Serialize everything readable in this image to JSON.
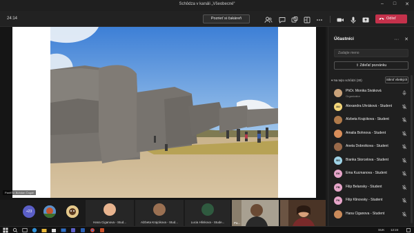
{
  "window": {
    "title": "Schôdza v kanáli „Všeobecné“"
  },
  "toolbar": {
    "timer": "24:14",
    "waiting_button": "Pozrieť si čakáreň",
    "leave_button": "Odísť"
  },
  "stage": {
    "presenter_label": "PanItTv. Bohdan Čagáň"
  },
  "strip": {
    "overflow_count": "+23",
    "tiles": [
      {
        "name": "Hana Ciganova - Stud..."
      },
      {
        "name": "Alzbeta Krajcikova - Stud..."
      },
      {
        "name": "Lucia Hlinkova - Stude..."
      },
      {
        "name": "Pa..."
      }
    ]
  },
  "panel": {
    "title": "Účastníci",
    "invite_placeholder": "Zadajte meno",
    "share_button": "Zdieľať pozvánku",
    "section_label": "Na tejto schôdzi (30)",
    "mute_all_button": "Stlmiť všetkých",
    "participants": [
      {
        "name": "PhDr. Monika Siváková",
        "role": "Organizátor",
        "initials": "",
        "color": "#c9a27a"
      },
      {
        "name": "Alexandra Uhráková - Student",
        "role": "",
        "initials": "AU",
        "color": "#f5d77a"
      },
      {
        "name": "Alzbeta Krajcikova - Student",
        "role": "",
        "initials": "",
        "color": "#b07a4a"
      },
      {
        "name": "Amalia Bohnova - Student",
        "role": "",
        "initials": "",
        "color": "#d98e5a"
      },
      {
        "name": "Aneta Dobrotkova - Student",
        "role": "",
        "initials": "",
        "color": "#9a6a4a"
      },
      {
        "name": "Bianka Storcelova - Student",
        "role": "",
        "initials": "BS",
        "color": "#9fd3e6"
      },
      {
        "name": "Ema Kucmanova - Student",
        "role": "",
        "initials": "EK",
        "color": "#e6a5c9"
      },
      {
        "name": "Filip Belansky - Student",
        "role": "",
        "initials": "FB",
        "color": "#e6a5c9"
      },
      {
        "name": "Filip Klinovsky - Student",
        "role": "",
        "initials": "FK",
        "color": "#e6a5c9"
      },
      {
        "name": "Hana Ciganova - Student",
        "role": "",
        "initials": "",
        "color": "#c98a5a"
      }
    ]
  },
  "taskbar": {
    "lang": "SUK",
    "time": "12:24"
  }
}
